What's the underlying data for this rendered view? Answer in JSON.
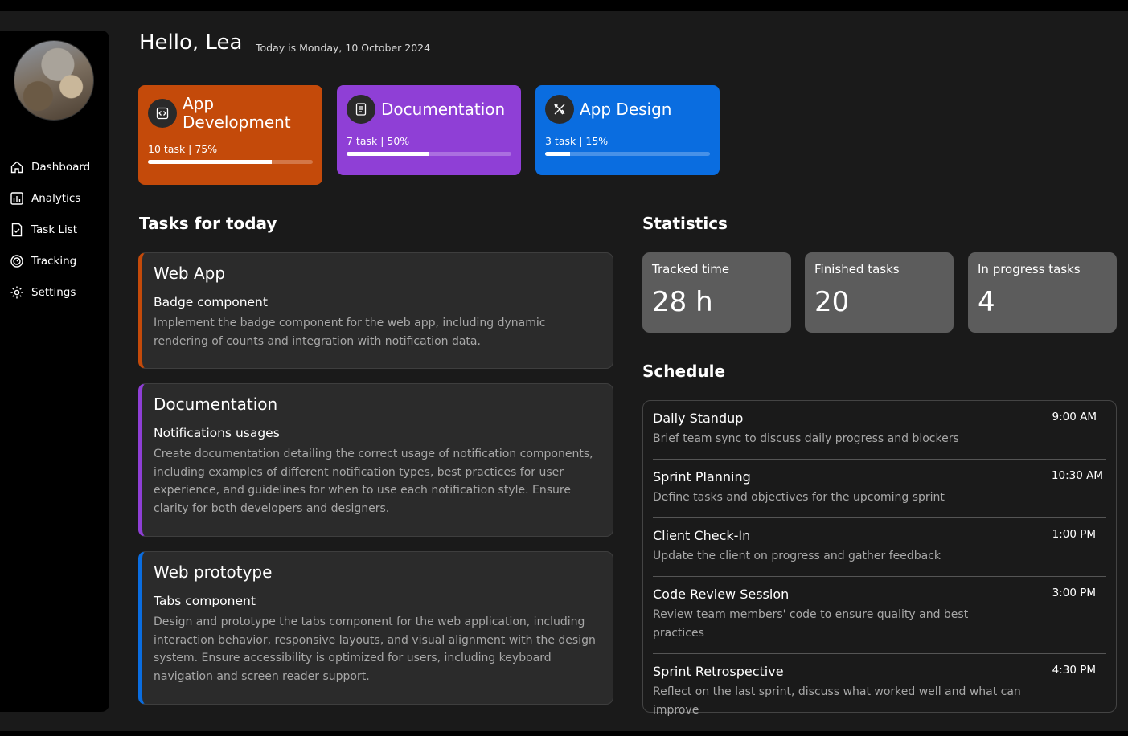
{
  "header": {
    "greeting": "Hello, Lea",
    "date": "Today is Monday, 10 October 2024"
  },
  "sidebar": {
    "items": [
      {
        "label": "Dashboard",
        "icon": "home-icon"
      },
      {
        "label": "Analytics",
        "icon": "analytics-icon"
      },
      {
        "label": "Task List",
        "icon": "task-list-icon"
      },
      {
        "label": "Tracking",
        "icon": "tracking-icon"
      },
      {
        "label": "Settings",
        "icon": "settings-icon"
      }
    ]
  },
  "projects": [
    {
      "title": "App Development",
      "stats": "10 task | 75%",
      "progress": 0.75,
      "color": "#c44a0a",
      "icon": "code-icon"
    },
    {
      "title": "Documentation",
      "stats": "7 task | 50%",
      "progress": 0.5,
      "color": "#8f3fd6",
      "icon": "document-icon"
    },
    {
      "title": "App Design",
      "stats": "3 task | 15%",
      "progress": 0.15,
      "color": "#0a6de0",
      "icon": "design-tools-icon"
    }
  ],
  "tasks_section": {
    "title": "Tasks for today"
  },
  "tasks": [
    {
      "project": "Web App",
      "name": "Badge component",
      "description": "Implement the badge component for the web app, including dynamic rendering of counts and integration with notification data.",
      "accent": "#c44a0a"
    },
    {
      "project": "Documentation",
      "name": "Notifications usages",
      "description": "Create documentation detailing the correct usage of notification components, including examples of different notification types, best practices for user experience, and guidelines for when to use each notification style. Ensure clarity for both developers and designers.",
      "accent": "#8f3fd6"
    },
    {
      "project": "Web prototype",
      "name": "Tabs component",
      "description": "Design and prototype the tabs component for the web application, including interaction behavior, responsive layouts, and visual alignment with the design system. Ensure accessibility is optimized for users, including keyboard navigation and screen reader support.",
      "accent": "#0a6de0"
    }
  ],
  "statistics": {
    "title": "Statistics",
    "items": [
      {
        "label": "Tracked time",
        "value": "28 h"
      },
      {
        "label": "Finished tasks",
        "value": "20"
      },
      {
        "label": "In progress tasks",
        "value": "4"
      }
    ]
  },
  "schedule": {
    "title": "Schedule",
    "items": [
      {
        "title": "Daily Standup",
        "description": "Brief team sync to discuss daily progress and blockers",
        "time": "9:00 AM"
      },
      {
        "title": "Sprint Planning",
        "description": "Define tasks and objectives for the upcoming sprint",
        "time": "10:30 AM"
      },
      {
        "title": "Client Check-In",
        "description": "Update the client on progress and gather feedback",
        "time": "1:00 PM"
      },
      {
        "title": "Code Review Session",
        "description": "Review team members' code to ensure quality and best practices",
        "time": "3:00 PM"
      },
      {
        "title": "Sprint Retrospective",
        "description": "Reflect on the last sprint, discuss what worked well and what can improve",
        "time": "4:30 PM"
      }
    ]
  }
}
